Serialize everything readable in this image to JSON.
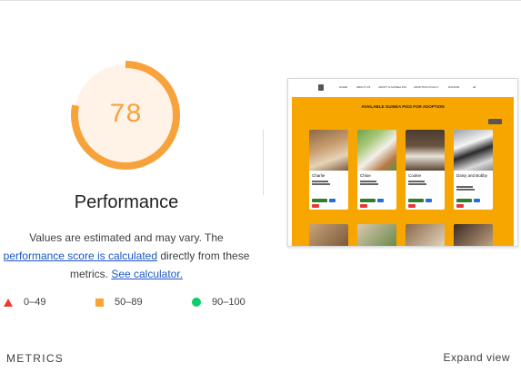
{
  "score": {
    "value": "78",
    "fraction": 0.78,
    "color": "#f7a23a",
    "track_color": "#fef3e6"
  },
  "performance": {
    "title": "Performance",
    "desc_text1": "Values are estimated and may vary. The",
    "desc_link1": "performance score is calculated",
    "desc_text2": "directly from these metrics.",
    "desc_link2": "See calculator."
  },
  "legend": [
    {
      "range": "0–49",
      "shape": "triangle",
      "color": "#eb3b2e"
    },
    {
      "range": "50–89",
      "shape": "square",
      "color": "#f9a236"
    },
    {
      "range": "90–100",
      "shape": "circle",
      "color": "#0cce6b"
    }
  ],
  "screenshot": {
    "nav": [
      "HOME",
      "ABOUT US",
      "ADOPT A GUINEA PIG",
      "ADOPTION POLICY",
      "DONATE"
    ],
    "heading": "AVAILABLE GUINEA PIGS FOR ADOPTION",
    "cards": [
      {
        "name": "Charlie"
      },
      {
        "name": "Chloe"
      },
      {
        "name": "Cookie"
      },
      {
        "name": "Daisy and Bobby"
      }
    ]
  },
  "footer": {
    "metrics_label": "METRICS",
    "expand_label": "Expand view"
  }
}
